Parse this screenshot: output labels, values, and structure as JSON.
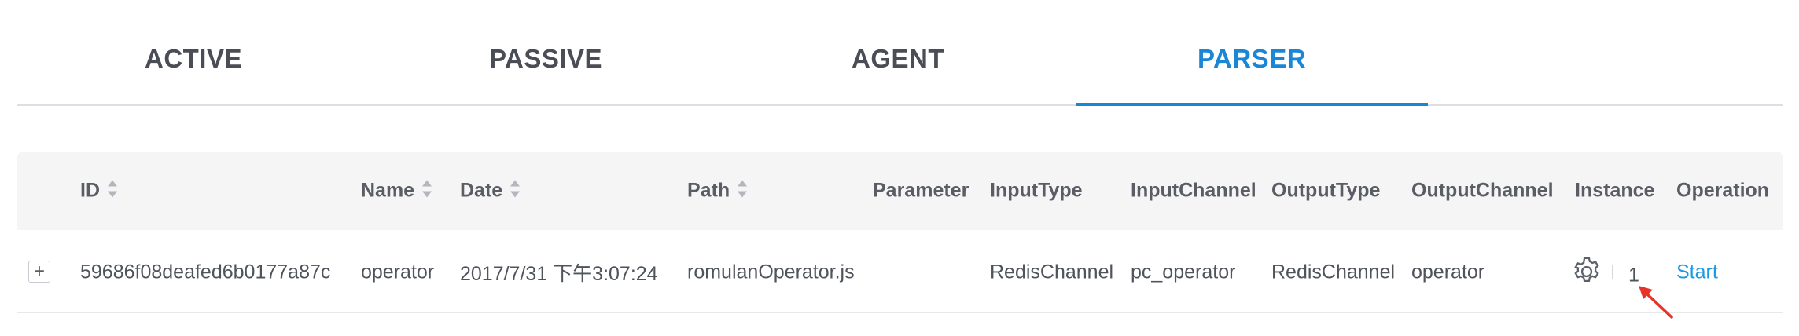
{
  "tabs": [
    {
      "label": "ACTIVE",
      "active": false
    },
    {
      "label": "PASSIVE",
      "active": false
    },
    {
      "label": "AGENT",
      "active": false
    },
    {
      "label": "PARSER",
      "active": true
    }
  ],
  "table": {
    "columns": {
      "id": "ID",
      "name": "Name",
      "date": "Date",
      "path": "Path",
      "parameter": "Parameter",
      "input_type": "InputType",
      "input_channel": "InputChannel",
      "output_type": "OutputType",
      "output_channel": "OutputChannel",
      "instance": "Instance",
      "operation": "Operation"
    },
    "rows": [
      {
        "expand": "+",
        "id": "59686f08deafed6b0177a87c",
        "name": "operator",
        "date": "2017/7/31 下午3:07:24",
        "path": "romulanOperator.js",
        "parameter": "",
        "input_type": "RedisChannel",
        "input_channel": "pc_operator",
        "output_type": "RedisChannel",
        "output_channel": "operator",
        "instance_icon": "gear-icon",
        "instance_count": "1",
        "operation": "Start"
      }
    ]
  },
  "colors": {
    "accent": "#1a87d6",
    "link": "#1a9ae0",
    "header_bg": "#f5f5f5",
    "annotation_arrow": "#e8332a"
  }
}
